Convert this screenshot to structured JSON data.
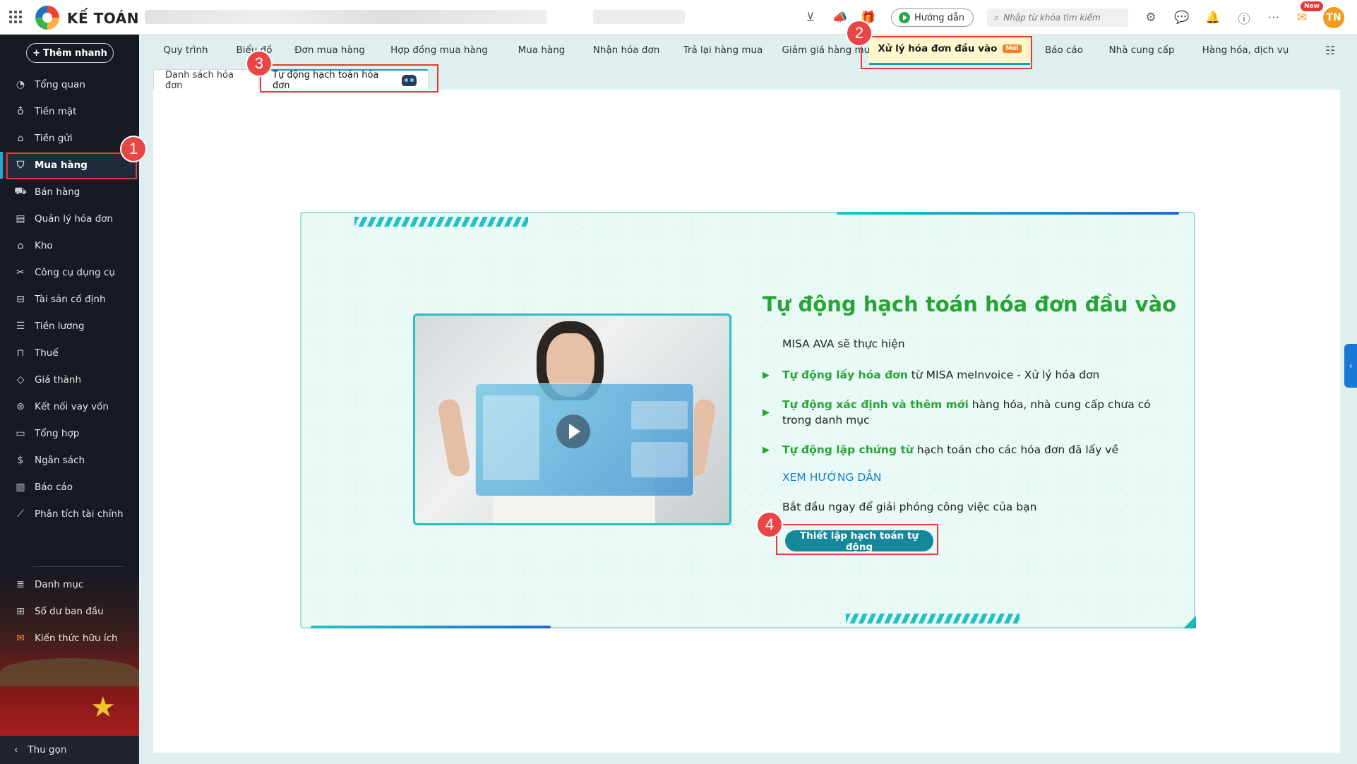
{
  "topbar": {
    "brand": "KẾ TOÁN",
    "guide_label": "Hướng dẫn",
    "search_placeholder": "Nhập từ khóa tìm kiếm",
    "new_badge": "New",
    "avatar_initials": "TN"
  },
  "sidebar": {
    "quick_add": "Thêm nhanh",
    "items": [
      {
        "label": "Tổng quan",
        "icon": "dashboard-icon"
      },
      {
        "label": "Tiền mặt",
        "icon": "money-bag-icon"
      },
      {
        "label": "Tiền gửi",
        "icon": "bank-icon"
      },
      {
        "label": "Mua hàng",
        "icon": "shopping-bag-icon"
      },
      {
        "label": "Bán hàng",
        "icon": "cart-icon"
      },
      {
        "label": "Quản lý hóa đơn",
        "icon": "invoice-icon"
      },
      {
        "label": "Kho",
        "icon": "warehouse-icon"
      },
      {
        "label": "Công cụ dụng cụ",
        "icon": "tools-icon"
      },
      {
        "label": "Tài sản cố định",
        "icon": "asset-icon"
      },
      {
        "label": "Tiền lương",
        "icon": "salary-icon"
      },
      {
        "label": "Thuế",
        "icon": "tax-icon"
      },
      {
        "label": "Giá thành",
        "icon": "price-tag-icon"
      },
      {
        "label": "Kết nối vay vốn",
        "icon": "loan-icon"
      },
      {
        "label": "Tổng hợp",
        "icon": "summary-icon"
      },
      {
        "label": "Ngân sách",
        "icon": "budget-icon"
      },
      {
        "label": "Báo cáo",
        "icon": "report-icon"
      },
      {
        "label": "Phân tích tài chính",
        "icon": "analysis-icon"
      },
      {
        "label": "Danh mục",
        "icon": "list-icon"
      },
      {
        "label": "Số dư ban đầu",
        "icon": "balance-icon"
      },
      {
        "label": "Kiến thức hữu ích",
        "icon": "knowledge-icon"
      }
    ],
    "collapse_label": "Thu gọn"
  },
  "tabs": [
    {
      "label": "Quy trình"
    },
    {
      "label": "Biểu đồ"
    },
    {
      "label": "Đơn mua hàng"
    },
    {
      "label": "Hợp đồng mua hàng"
    },
    {
      "label": "Mua hàng"
    },
    {
      "label": "Nhận hóa đơn"
    },
    {
      "label": "Trả lại hàng mua"
    },
    {
      "label": "Giảm giá hàng mua"
    },
    {
      "label": "Xử lý hóa đơn đầu vào",
      "badge": "Mới"
    },
    {
      "label": "Báo cáo"
    },
    {
      "label": "Nhà cung cấp"
    },
    {
      "label": "Hàng hóa, dịch vụ"
    }
  ],
  "subtabs": [
    {
      "label": "Danh sách hóa đơn"
    },
    {
      "label": "Tự động hạch toán hóa đơn"
    }
  ],
  "hero": {
    "title": "Tự động hạch toán hóa đơn đầu vào",
    "intro": "MISA AVA sẽ thực hiện",
    "bullets": [
      {
        "bold": "Tự động lấy hóa đơn",
        "rest": " từ MISA meInvoice - Xử lý hóa đơn"
      },
      {
        "bold": "Tự động xác định và thêm mới",
        "rest": " hàng hóa, nhà cung cấp chưa có trong danh mục"
      },
      {
        "bold": "Tự động lập chứng từ",
        "rest": " hạch toán cho các hóa đơn đã lấy về"
      }
    ],
    "guide_link": "XEM HƯỚNG DẪN",
    "start_text": "Bắt đầu ngay để giải phóng công việc của bạn",
    "setup_button": "Thiết lập hạch toán tự động"
  },
  "steps": [
    "1",
    "2",
    "3",
    "4"
  ],
  "colors": {
    "accent": "#28a437",
    "primary_button": "#17889c",
    "sidebar_bg": "#161a22",
    "highlight": "#e53935"
  }
}
